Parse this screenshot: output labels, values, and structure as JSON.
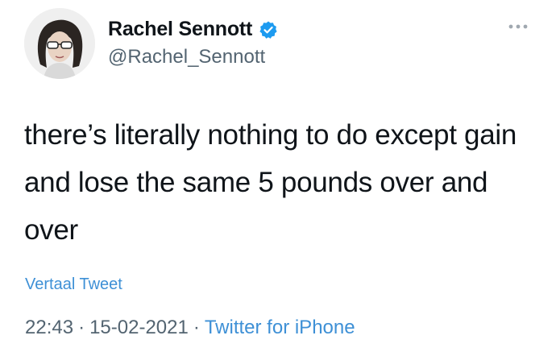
{
  "tweet": {
    "author": {
      "display_name": "Rachel Sennott",
      "handle": "@Rachel_Sennott",
      "verified": true,
      "avatar_icon": "profile-photo"
    },
    "text": "there’s literally nothing to do except gain and lose the same 5 pounds over and over",
    "translate_label": "Vertaal Tweet",
    "time": "22:43",
    "date": "15-02-2021",
    "separator": "·",
    "source": "Twitter for iPhone",
    "more_icon": "more-dots-icon"
  },
  "colors": {
    "link": "#3e90d6",
    "verified": "#1d9bf0",
    "secondary_text": "#536471",
    "primary_text": "#0f1419"
  }
}
